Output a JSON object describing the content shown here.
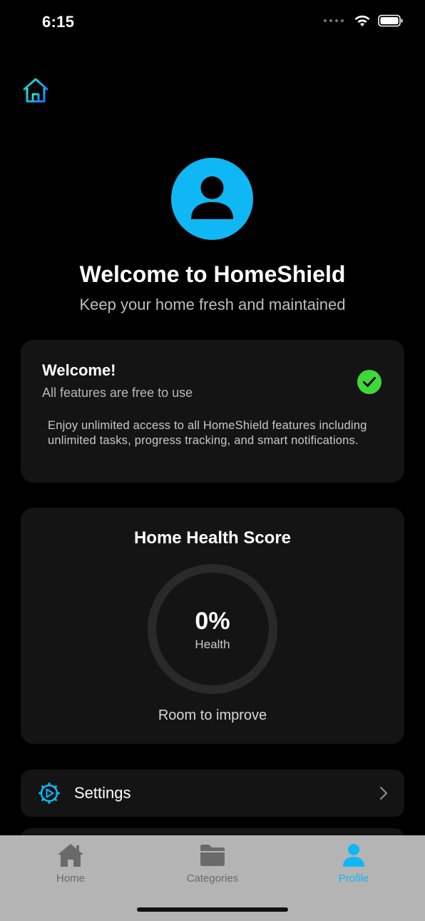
{
  "status_bar": {
    "time": "6:15"
  },
  "header": {
    "home_icon": "home-icon"
  },
  "profile": {
    "avatar_icon": "person-icon",
    "title": "Welcome to HomeShield",
    "subtitle": "Keep your home fresh and maintained"
  },
  "free_card": {
    "title": "Welcome!",
    "subtitle": "All features are free to use",
    "body": "Enjoy unlimited access to all HomeShield features including unlimited tasks, progress tracking, and smart notifications.",
    "status_icon": "checkmark-circle-icon"
  },
  "health_card": {
    "title": "Home Health Score",
    "value": "0%",
    "value_fraction": 0,
    "label": "Health",
    "caption": "Room to improve"
  },
  "settings_row": {
    "label": "Settings",
    "icon": "gear-icon"
  },
  "tab_bar": {
    "tabs": [
      {
        "label": "Home",
        "icon": "house-icon",
        "active": false
      },
      {
        "label": "Categories",
        "icon": "folder-icon",
        "active": false
      },
      {
        "label": "Profile",
        "icon": "person-icon",
        "active": true
      }
    ]
  },
  "colors": {
    "accent": "#0fb8f5",
    "success": "#3ed83a",
    "background": "#000000",
    "card": "#141414",
    "tab_bar": "#b4b4b4"
  }
}
